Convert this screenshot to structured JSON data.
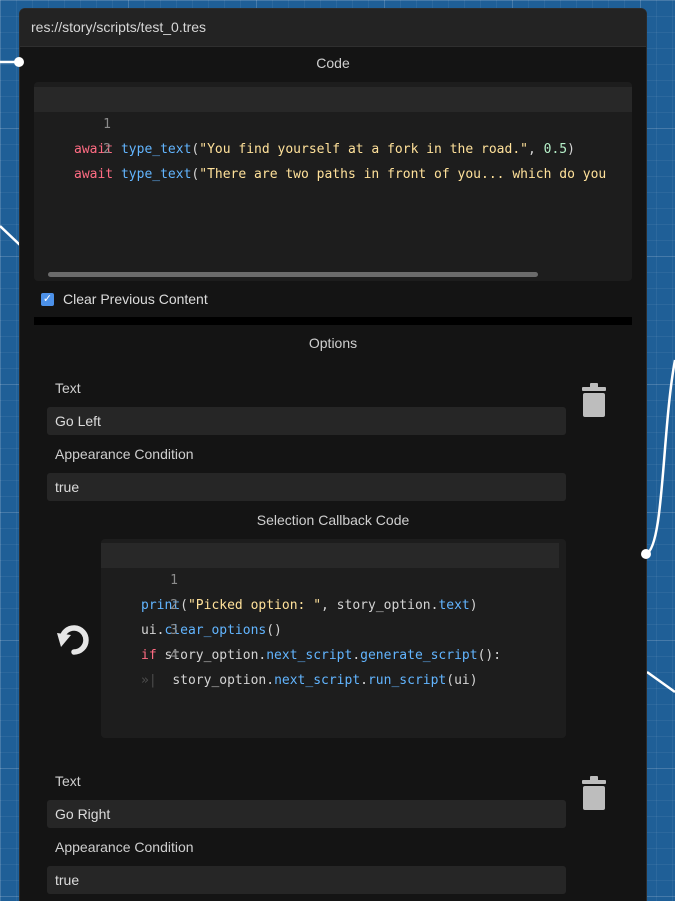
{
  "node": {
    "title": "res://story/scripts/test_0.tres"
  },
  "code_section": {
    "label": "Code",
    "lines": [
      {
        "number": "1",
        "tokens": [
          {
            "t": "await",
            "c": "kw"
          },
          {
            "t": " ",
            "c": "plain"
          },
          {
            "t": "type_text",
            "c": "fn"
          },
          {
            "t": "(",
            "c": "plain"
          },
          {
            "t": "\"You find yourself at a fork in the road.\"",
            "c": "str"
          },
          {
            "t": ", ",
            "c": "plain"
          },
          {
            "t": "0.5",
            "c": "num"
          },
          {
            "t": ")",
            "c": "plain"
          }
        ]
      },
      {
        "number": "2",
        "tokens": [
          {
            "t": "await",
            "c": "kw"
          },
          {
            "t": " ",
            "c": "plain"
          },
          {
            "t": "type_text",
            "c": "fn"
          },
          {
            "t": "(",
            "c": "plain"
          },
          {
            "t": "\"There are two paths in front of you... which do you",
            "c": "str"
          }
        ]
      }
    ]
  },
  "clear_previous": {
    "label": "Clear Previous Content",
    "checked": true
  },
  "options_section": {
    "label": "Options",
    "options": [
      {
        "text_label": "Text",
        "text_value": "Go Left",
        "condition_label": "Appearance Condition",
        "condition_value": "true",
        "callback_label": "Selection Callback Code",
        "callback_lines": [
          {
            "number": "1",
            "tokens": [
              {
                "t": "print",
                "c": "fn"
              },
              {
                "t": "(",
                "c": "plain"
              },
              {
                "t": "\"Picked option: \"",
                "c": "str"
              },
              {
                "t": ", story_option.",
                "c": "plain"
              },
              {
                "t": "text",
                "c": "fn"
              },
              {
                "t": ")",
                "c": "plain"
              }
            ]
          },
          {
            "number": "2",
            "tokens": [
              {
                "t": "ui.",
                "c": "plain"
              },
              {
                "t": "clear_options",
                "c": "fn"
              },
              {
                "t": "()",
                "c": "plain"
              }
            ]
          },
          {
            "number": "3",
            "tokens": [
              {
                "t": "if",
                "c": "kw"
              },
              {
                "t": " story_option.",
                "c": "plain"
              },
              {
                "t": "next_script",
                "c": "fn"
              },
              {
                "t": ".",
                "c": "plain"
              },
              {
                "t": "generate_script",
                "c": "fn"
              },
              {
                "t": "():",
                "c": "plain"
              }
            ]
          },
          {
            "number": "4",
            "tokens": [
              {
                "t": "»|  ",
                "c": "tab-mark"
              },
              {
                "t": "story_option.",
                "c": "plain"
              },
              {
                "t": "next_script",
                "c": "fn"
              },
              {
                "t": ".",
                "c": "plain"
              },
              {
                "t": "run_script",
                "c": "fn"
              },
              {
                "t": "(ui)",
                "c": "plain"
              }
            ]
          }
        ]
      },
      {
        "text_label": "Text",
        "text_value": "Go Right",
        "condition_label": "Appearance Condition",
        "condition_value": "true"
      }
    ]
  },
  "icons": {
    "delete": "trash-icon",
    "reset": "undo-icon",
    "check": "check-icon"
  },
  "colors": {
    "accent": "#4c91e9",
    "graph_background": "#1f5f97",
    "panel": "#141414"
  }
}
